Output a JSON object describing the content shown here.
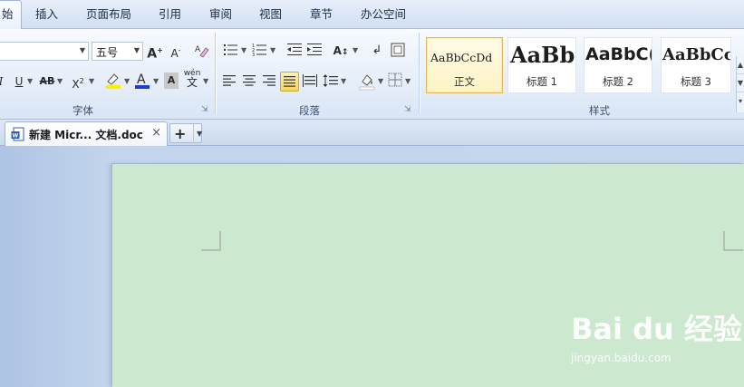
{
  "menu": {
    "items": [
      {
        "label": "始",
        "active": true
      },
      {
        "label": "插入"
      },
      {
        "label": "页面布局"
      },
      {
        "label": "引用"
      },
      {
        "label": "审阅"
      },
      {
        "label": "视图"
      },
      {
        "label": "章节"
      },
      {
        "label": "办公空间"
      }
    ]
  },
  "ribbon": {
    "font": {
      "font_name": "",
      "font_size": "五号",
      "label": "字体"
    },
    "paragraph": {
      "label": "段落"
    },
    "styles": {
      "label": "样式",
      "items": [
        {
          "sample": "AaBbCcDd",
          "name": "正文"
        },
        {
          "sample": "AaBb(",
          "name": "标题 1"
        },
        {
          "sample": "AaBbC(",
          "name": "标题 2"
        },
        {
          "sample": "AaBbCc",
          "name": "标题 3"
        }
      ]
    }
  },
  "tabs": {
    "doc_title": "新建 Micr... 文档.doc",
    "close_glyph": "×",
    "new_tab_glyph": "+"
  },
  "watermark": {
    "logo": "Bai du 经验",
    "sub": "jingyan.baidu.com"
  },
  "colors": {
    "page_background": "#cce8cf",
    "accent_yellow": "#f7d663",
    "font_color_blue": "#1f3bd8",
    "highlight_yellow": "#ffee00"
  }
}
